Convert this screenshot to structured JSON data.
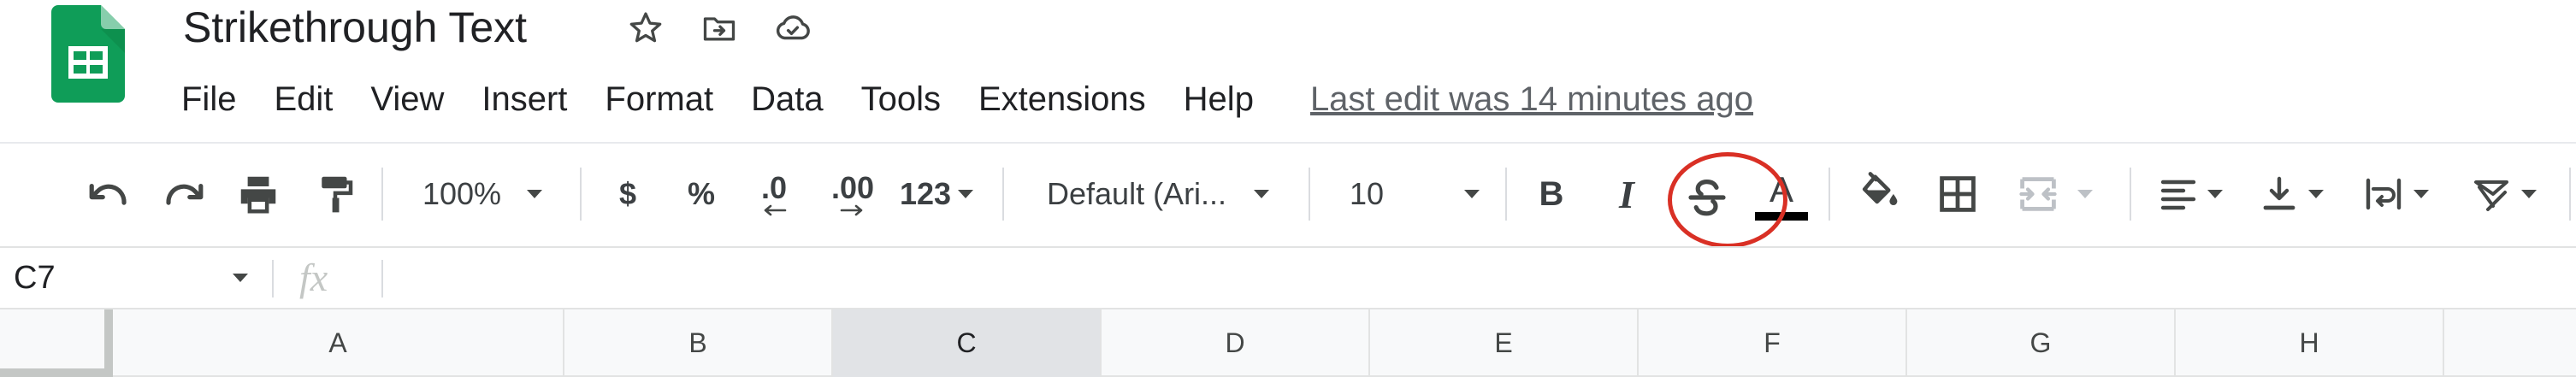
{
  "document": {
    "title": "Strikethrough Text",
    "last_edit": "Last edit was 14 minutes ago"
  },
  "menu": [
    "File",
    "Edit",
    "View",
    "Insert",
    "Format",
    "Data",
    "Tools",
    "Extensions",
    "Help"
  ],
  "toolbar": {
    "zoom": "100%",
    "currency": "$",
    "percent": "%",
    "decrease_decimal": ".0",
    "increase_decimal": ".00",
    "more_formats": "123",
    "font_family": "Default (Ari...",
    "font_size": "10",
    "bold": "B",
    "italic": "I",
    "text_color": "A",
    "highlighted_tool": "strikethrough",
    "highlight_color": "#d93025"
  },
  "icons": {
    "undo": "undo-icon",
    "redo": "redo-icon",
    "print": "print-icon",
    "paint_format": "paint-format-icon",
    "strikethrough": "strikethrough-icon",
    "fill_color": "fill-color-icon",
    "borders": "borders-icon",
    "merge": "merge-cells-icon",
    "h_align": "align-left-icon",
    "v_align": "vertical-align-bottom-icon",
    "wrap": "text-wrap-icon",
    "rotate": "text-rotation-icon",
    "star": "star-icon",
    "move": "move-to-folder-icon",
    "cloud": "cloud-saved-icon"
  },
  "formula_bar": {
    "cell_ref": "C7",
    "fx": "fx",
    "value": ""
  },
  "columns": [
    "A",
    "B",
    "C",
    "D",
    "E",
    "F",
    "G",
    "H"
  ],
  "selected_column": "C",
  "colors": {
    "sheets_green": "#0f9d58",
    "toolbar_icon": "#444746",
    "header_bg": "#f8f9fa",
    "selected_header_bg": "#e1e3e6"
  }
}
